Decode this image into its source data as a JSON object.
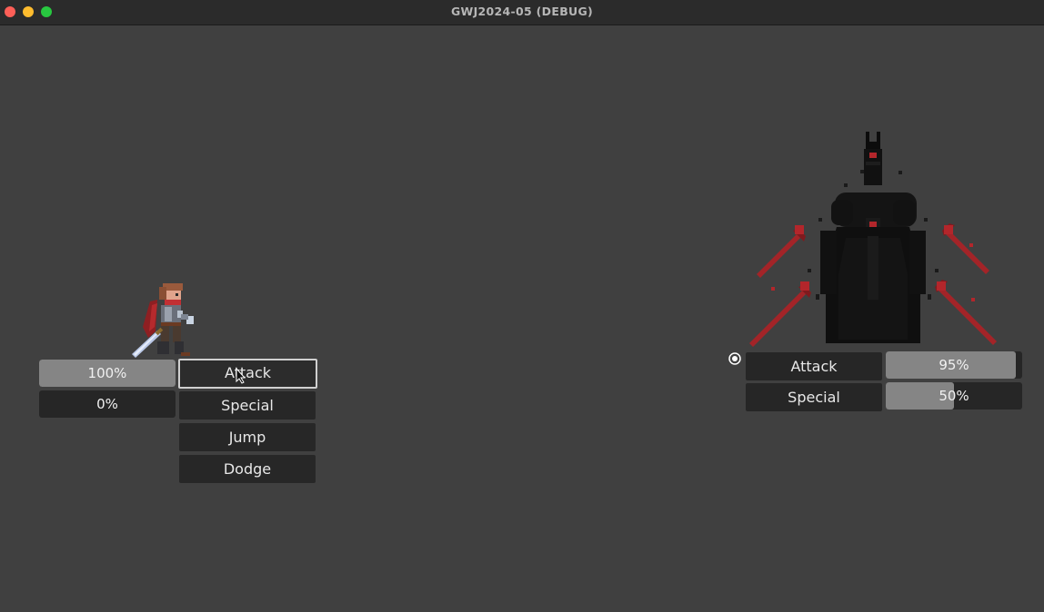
{
  "window": {
    "title": "GWJ2024-05 (DEBUG)"
  },
  "player": {
    "health": {
      "label": "100%",
      "fraction": 1.0
    },
    "energy": {
      "label": "0%",
      "fraction": 0.0
    },
    "actions": [
      "Attack",
      "Special",
      "Jump",
      "Dodge"
    ],
    "focused_action": "Attack"
  },
  "enemy": {
    "intents": [
      {
        "label": "Attack",
        "chance_label": "95%",
        "chance": 0.95
      },
      {
        "label": "Special",
        "chance_label": "50%",
        "chance": 0.5
      }
    ]
  },
  "colors": {
    "bar_fill": "#858585",
    "bar_bg": "#262626",
    "enemy_red": "#b3262b"
  }
}
